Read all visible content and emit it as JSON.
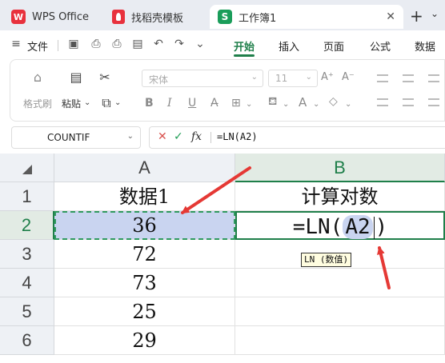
{
  "tabs": [
    {
      "label": "WPS Office",
      "icon": "wps-logo-icon"
    },
    {
      "label": "找稻壳模板",
      "icon": "docer-logo-icon"
    },
    {
      "label": "工作簿1",
      "icon": "spreadsheet-logo-icon",
      "active": true
    }
  ],
  "tab_icons": {
    "wps": "W",
    "sheet": "S",
    "close": "✕",
    "new": "+",
    "more": "⌄"
  },
  "menu": {
    "file": "文件",
    "items": [
      "开始",
      "插入",
      "页面",
      "公式",
      "数据"
    ],
    "active": "开始"
  },
  "ribbon": {
    "format_painter": "格式刷",
    "paste": "粘贴",
    "font_name": "宋体",
    "font_size": "11"
  },
  "formula_bar": {
    "name_box": "COUNTIF",
    "cancel": "✕",
    "confirm": "✓",
    "fx": "fx",
    "formula": "=LN(A2)"
  },
  "sheet": {
    "columns": [
      "A",
      "B"
    ],
    "selected_column": "B",
    "rows": [
      "1",
      "2",
      "3",
      "4",
      "5",
      "6"
    ],
    "selected_row": "2",
    "cells": {
      "A1": "数据1",
      "B1": "计算对数",
      "A2": "36",
      "A3": "72",
      "A4": "73",
      "A5": "25",
      "A6": "29"
    },
    "b2_edit": {
      "prefix": "=LN(",
      "ref": "A2",
      "suffix": ")"
    },
    "tooltip": "LN (数值)"
  },
  "colors": {
    "accent": "#1f7f4a",
    "annotation_arrow": "#e53935",
    "ref_highlight": "#c9d4f0"
  }
}
